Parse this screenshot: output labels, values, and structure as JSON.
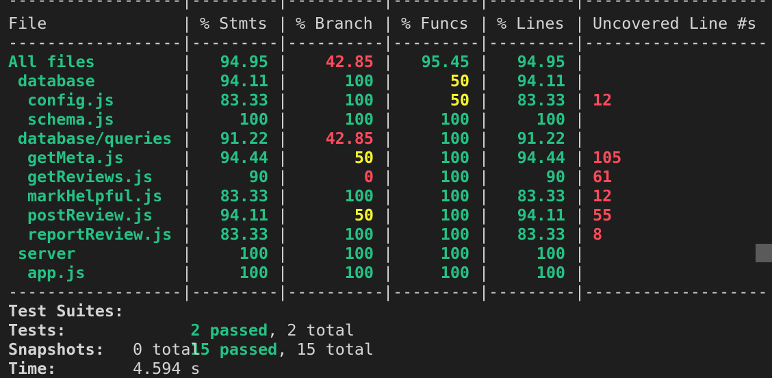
{
  "colors": {
    "background": "#1e1e1e",
    "default": "#d4d4d4",
    "green": "#25c285",
    "red": "#ff4b5c",
    "yellow": "#f7f531",
    "scrollbar": "#5a5a5a"
  },
  "coverage_table": {
    "headers": {
      "file": "File",
      "stmts": "% Stmts",
      "branch": "% Branch",
      "funcs": "% Funcs",
      "lines": "% Lines",
      "uncovered": "Uncovered Line #s"
    },
    "rows": [
      {
        "file": "All files",
        "stmts": "94.95",
        "branch": "42.85",
        "funcs": "95.45",
        "lines": "94.95",
        "uncovered": ""
      },
      {
        "file": "database",
        "stmts": "94.11",
        "branch": "100",
        "funcs": "50",
        "lines": "94.11",
        "uncovered": ""
      },
      {
        "file": "config.js",
        "stmts": "83.33",
        "branch": "100",
        "funcs": "50",
        "lines": "83.33",
        "uncovered": "12"
      },
      {
        "file": "schema.js",
        "stmts": "100",
        "branch": "100",
        "funcs": "100",
        "lines": "100",
        "uncovered": ""
      },
      {
        "file": "database/queries",
        "stmts": "91.22",
        "branch": "42.85",
        "funcs": "100",
        "lines": "91.22",
        "uncovered": ""
      },
      {
        "file": "getMeta.js",
        "stmts": "94.44",
        "branch": "50",
        "funcs": "100",
        "lines": "94.44",
        "uncovered": "105"
      },
      {
        "file": "getReviews.js",
        "stmts": "90",
        "branch": "0",
        "funcs": "100",
        "lines": "90",
        "uncovered": "61"
      },
      {
        "file": "markHelpful.js",
        "stmts": "83.33",
        "branch": "100",
        "funcs": "100",
        "lines": "83.33",
        "uncovered": "12"
      },
      {
        "file": "postReview.js",
        "stmts": "94.11",
        "branch": "50",
        "funcs": "100",
        "lines": "94.11",
        "uncovered": "55"
      },
      {
        "file": "reportReview.js",
        "stmts": "83.33",
        "branch": "100",
        "funcs": "100",
        "lines": "83.33",
        "uncovered": "8"
      },
      {
        "file": "server",
        "stmts": "100",
        "branch": "100",
        "funcs": "100",
        "lines": "100",
        "uncovered": ""
      },
      {
        "file": "app.js",
        "stmts": "100",
        "branch": "100",
        "funcs": "100",
        "lines": "100",
        "uncovered": ""
      }
    ]
  },
  "summary": {
    "suites_label": "Test Suites:",
    "suites_passed": "2 passed",
    "suites_rest": ", 2 total",
    "tests_label": "Tests:",
    "tests_passed": "15 passed",
    "tests_rest": ", 15 total",
    "snapshots_label": "Snapshots:",
    "snapshots_value": "0 total",
    "time_label": "Time:",
    "time_value": "4.594 s"
  }
}
